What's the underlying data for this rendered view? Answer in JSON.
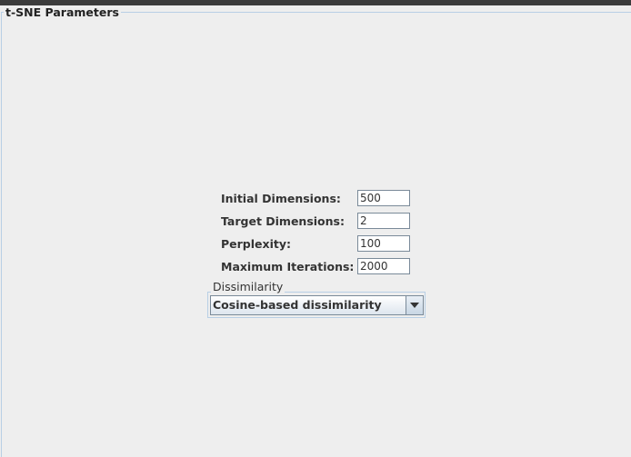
{
  "panel": {
    "title": "t-SNE Parameters"
  },
  "fields": {
    "initial_dimensions": {
      "label": "Initial Dimensions:",
      "value": "500"
    },
    "target_dimensions": {
      "label": "Target Dimensions:",
      "value": "2"
    },
    "perplexity": {
      "label": "Perplexity:",
      "value": "100"
    },
    "max_iterations": {
      "label": "Maximum Iterations:",
      "value": "2000"
    }
  },
  "dissimilarity": {
    "group_title": "Dissimilarity",
    "selected": "Cosine-based dissimilarity",
    "dropdown_icon": "chevron-down-icon"
  }
}
